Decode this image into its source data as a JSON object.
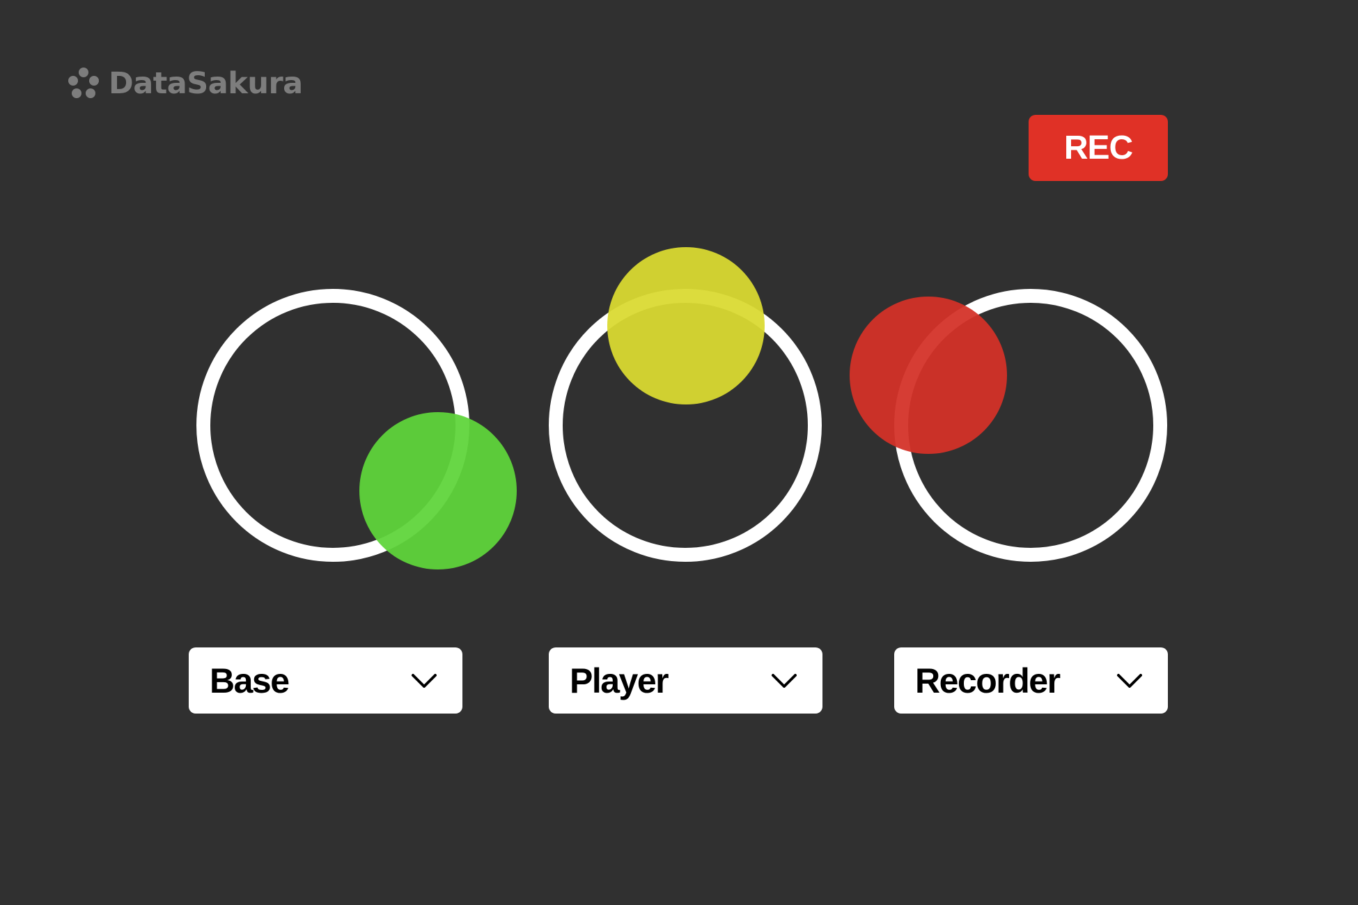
{
  "brand": {
    "name": "DataSakura",
    "color": "#7d7d7d"
  },
  "record_button": {
    "label": "REC",
    "color": "#e03126"
  },
  "channels": [
    {
      "id": "base",
      "selected": "Base",
      "dot_color": "#5fd43a",
      "icon": "chevron-down-icon"
    },
    {
      "id": "player",
      "selected": "Player",
      "dot_color": "#dada31",
      "icon": "chevron-down-icon"
    },
    {
      "id": "recorder",
      "selected": "Recorder",
      "dot_color": "#d33127",
      "icon": "chevron-down-icon"
    }
  ],
  "colors": {
    "background": "#303030",
    "ring": "#ffffff",
    "dropdown_bg": "#ffffff",
    "dropdown_text": "#000000"
  }
}
